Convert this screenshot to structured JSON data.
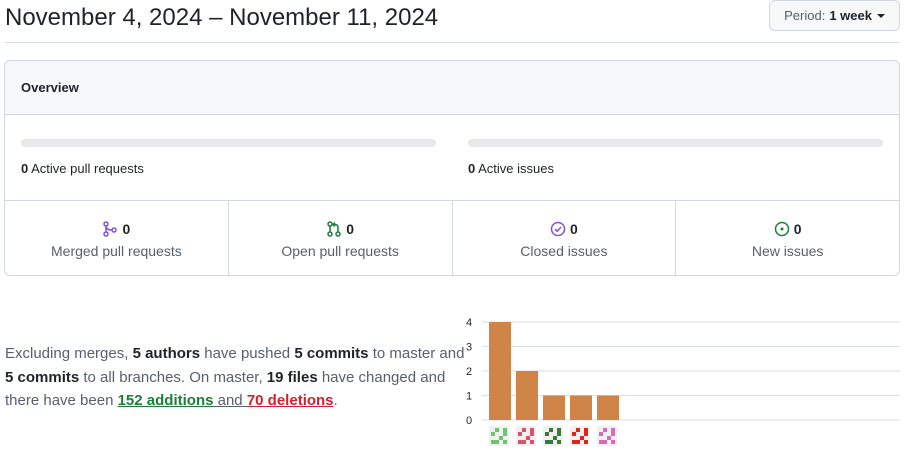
{
  "header": {
    "date_range": "November 4, 2024 – November 11, 2024",
    "period_label": "Period:",
    "period_value": "1 week"
  },
  "overview": {
    "title": "Overview",
    "active_pull_requests": {
      "count": "0",
      "label": "Active pull requests"
    },
    "active_issues": {
      "count": "0",
      "label": "Active issues"
    },
    "stats": [
      {
        "icon": "merged-pr-icon",
        "count": "0",
        "label": "Merged pull requests",
        "color": "#8250df"
      },
      {
        "icon": "open-pr-icon",
        "count": "0",
        "label": "Open pull requests",
        "color": "#1a7f37"
      },
      {
        "icon": "closed-issue-icon",
        "count": "0",
        "label": "Closed issues",
        "color": "#8250df"
      },
      {
        "icon": "new-issue-icon",
        "count": "0",
        "label": "New issues",
        "color": "#1a7f37"
      }
    ]
  },
  "summary": {
    "p1": "Excluding merges, ",
    "authors": "5 authors",
    "p2": " have pushed ",
    "commits_master": "5 commits",
    "p3": " to master and ",
    "commits_all": "5 commits",
    "p4": " to all branches. On master, ",
    "files": "19 files",
    "p5": " have changed and there have been ",
    "additions": "152 additions",
    "p6": " and ",
    "deletions": "70 deletions",
    "p7": "."
  },
  "chart_data": {
    "type": "bar",
    "categories": [
      "author-1",
      "author-2",
      "author-3",
      "author-4",
      "author-5"
    ],
    "values": [
      4,
      2,
      1,
      1,
      1
    ],
    "ylim": [
      0,
      4
    ],
    "yticks": [
      "0",
      "1",
      "2",
      "3",
      "4"
    ],
    "bar_color": "#d18447",
    "avatar_colors": [
      "#6fc36f",
      "#d9536a",
      "#3b7a3b",
      "#e0241b",
      "#d96ab8"
    ]
  }
}
